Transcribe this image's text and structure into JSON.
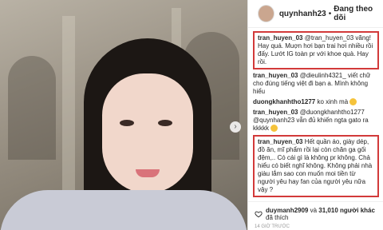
{
  "header": {
    "username": "quynhanh23",
    "dot": "•",
    "follow_label": "Đang theo dõi"
  },
  "comments": [
    {
      "user": "tran_huyen_03",
      "text": "@tran_huyen_03 vãng! Hay quá. Muợn hơi bạn trai hơi nhiều rồi đấy. Lướt IG toàn pr với khoe quà. Hay rồi.",
      "highlight": true
    },
    {
      "user": "tran_huyen_03",
      "text": "@dieulinh4321_ viết chữ cho đúng tiếng việt đi bạn a. Mình không hiểu",
      "highlight": false
    },
    {
      "user": "duongkhanhtho1277",
      "text": "ko xinh mà",
      "highlight": false
    },
    {
      "user": "tran_huyen_03",
      "text": "@duongkhanhtho1277 @quynhanh23 vẫn đủ khiến ngta gato ra kkkkk",
      "highlight": false
    },
    {
      "user": "tran_huyen_03",
      "text": "Hết quần áo, giày dép, đồ ăn, mĩ phẩm rồi lại còn chăn ga gối đệm,.. Có cái gì là không pr không. Chả hiểu có biết nghĩ không. Không phải nhà giàu lắm sao con muốn moi tiền từ người yêu hay fan của người yêu nữa vậy ?",
      "highlight": true
    }
  ],
  "footer": {
    "liker1": "duymanh2909",
    "and": "và",
    "others": "31,010 người khác",
    "suffix": "đã thích",
    "ago": "14 GIỜ TRƯỚC"
  }
}
